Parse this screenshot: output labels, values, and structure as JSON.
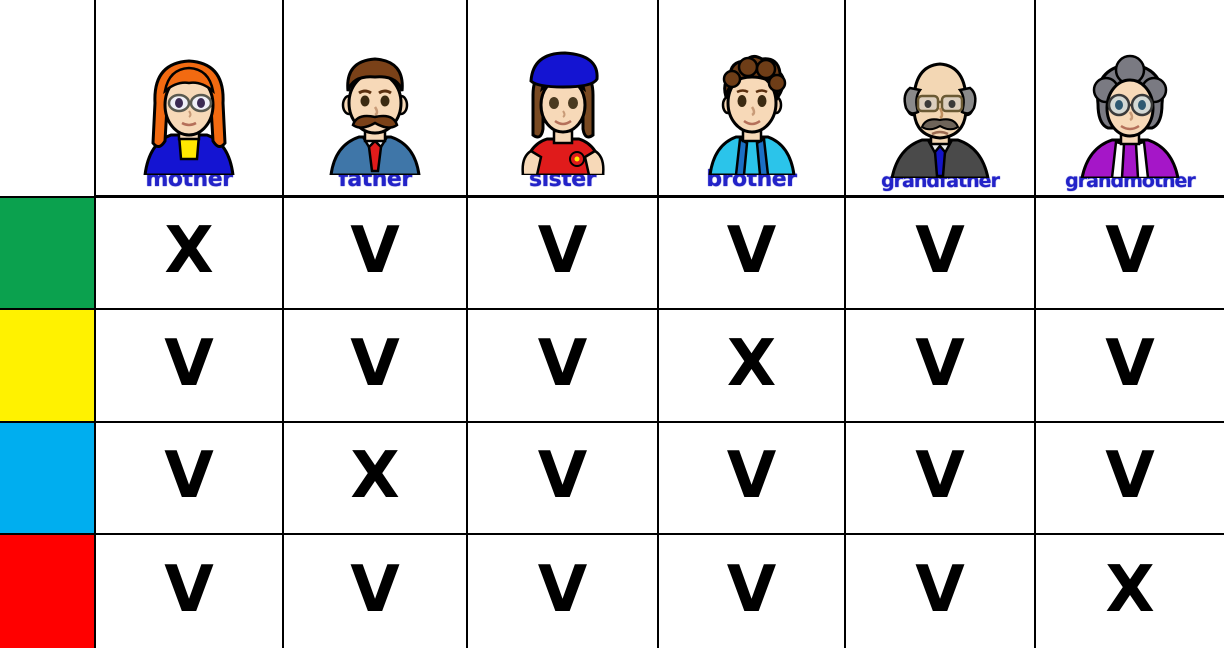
{
  "table": {
    "columns": [
      {
        "key": "rowcolor",
        "label": ""
      },
      {
        "key": "mother",
        "label": "mother",
        "icon": "mother-portrait-icon"
      },
      {
        "key": "father",
        "label": "father",
        "icon": "father-portrait-icon"
      },
      {
        "key": "sister",
        "label": "sister",
        "icon": "sister-portrait-icon"
      },
      {
        "key": "brother",
        "label": "brother",
        "icon": "brother-portrait-icon"
      },
      {
        "key": "grandfather",
        "label": "grandfather",
        "icon": "grandfather-portrait-icon"
      },
      {
        "key": "grandmother",
        "label": "grandmother",
        "icon": "grandmother-portrait-icon"
      }
    ],
    "rows": [
      {
        "color": "#0BA14E",
        "color_name": "green",
        "marks": [
          "X",
          "V",
          "V",
          "V",
          "V",
          "V"
        ]
      },
      {
        "color": "#FFF200",
        "color_name": "yellow",
        "marks": [
          "V",
          "V",
          "V",
          "X",
          "V",
          "V"
        ]
      },
      {
        "color": "#00AEEF",
        "color_name": "cyan",
        "marks": [
          "V",
          "X",
          "V",
          "V",
          "V",
          "V"
        ]
      },
      {
        "color": "#FF0000",
        "color_name": "red",
        "marks": [
          "V",
          "V",
          "V",
          "V",
          "V",
          "X"
        ]
      }
    ]
  },
  "marks": {
    "yes": "V",
    "no": "X"
  },
  "colors": {
    "label_blue": "#2323c8",
    "grid_line": "#000000",
    "row_green": "#0BA14E",
    "row_yellow": "#FFF200",
    "row_cyan": "#00AEEF",
    "row_red": "#FF0000"
  }
}
